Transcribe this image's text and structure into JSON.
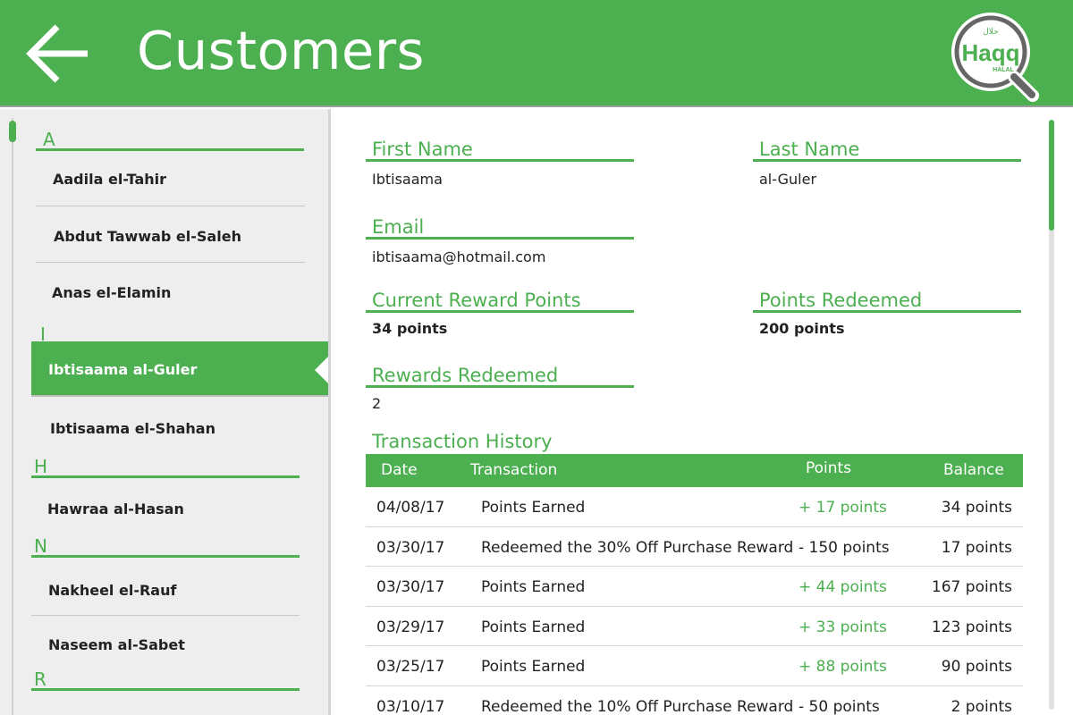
{
  "header": {
    "title": "Customers",
    "logo_text": "Haqq",
    "logo_sub": "HALAL",
    "logo_arabic": "حلال"
  },
  "sidebar": {
    "groups": [
      {
        "letter": "A",
        "items": [
          "Aadila el-Tahir",
          "Abdut Tawwab el-Saleh",
          "Anas el-Elamin"
        ]
      },
      {
        "letter": "I",
        "items": [
          "Ibtisaama al-Guler",
          "Ibtisaama el-Shahan"
        ]
      },
      {
        "letter": "H",
        "items": [
          "Hawraa al-Hasan"
        ]
      },
      {
        "letter": "N",
        "items": [
          "Nakheel el-Rauf",
          "Naseem al-Sabet"
        ]
      },
      {
        "letter": "R",
        "items": []
      }
    ],
    "selected": "Ibtisaama al-Guler"
  },
  "customer": {
    "first_name_label": "First Name",
    "first_name": "Ibtisaama",
    "last_name_label": "Last Name",
    "last_name": "al-Guler",
    "email_label": "Email",
    "email": "ibtisaama@hotmail.com",
    "current_points_label": "Current Reward Points",
    "current_points": "34 points",
    "points_redeemed_label": "Points Redeemed",
    "points_redeemed": "200 points",
    "rewards_redeemed_label": "Rewards Redeemed",
    "rewards_redeemed": "2"
  },
  "history": {
    "title": "Transaction History",
    "columns": [
      "Date",
      "Transaction",
      "Points",
      "Balance"
    ],
    "rows": [
      {
        "date": "04/08/17",
        "transaction": "Points Earned",
        "points": "+ 17 points",
        "balance": "34 points",
        "type": "earned"
      },
      {
        "date": "03/30/17",
        "transaction": "Redeemed the 30% Off Purchase Reward",
        "points": "- 150 points",
        "balance": "17 points",
        "type": "redeemed"
      },
      {
        "date": "03/30/17",
        "transaction": "Points Earned",
        "points": "+ 44 points",
        "balance": "167 points",
        "type": "earned"
      },
      {
        "date": "03/29/17",
        "transaction": "Points Earned",
        "points": "+ 33 points",
        "balance": "123 points",
        "type": "earned"
      },
      {
        "date": "03/25/17",
        "transaction": "Points Earned",
        "points": "+ 88 points",
        "balance": "90 points",
        "type": "earned"
      },
      {
        "date": "03/10/17",
        "transaction": "Redeemed the 10% Off Purchase Reward",
        "points": "- 50 points",
        "balance": "2 points",
        "type": "redeemed"
      }
    ]
  },
  "colors": {
    "accent": "#4caf50",
    "sidebar_bg": "#eeeeee"
  }
}
